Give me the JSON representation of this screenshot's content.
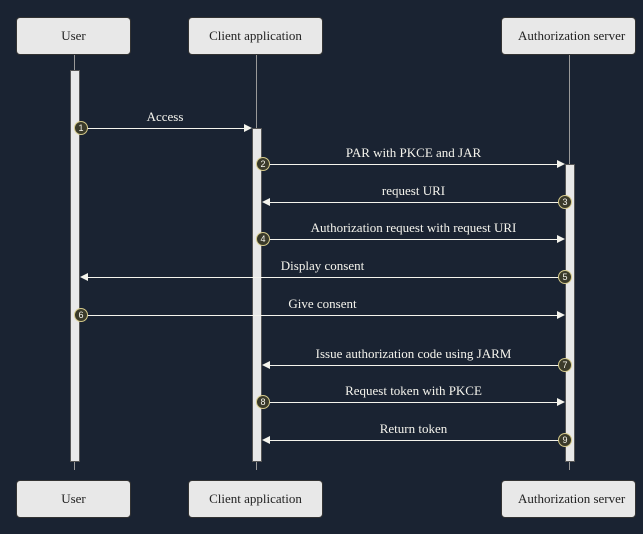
{
  "participants": {
    "user": "User",
    "client": "Client application",
    "server": "Authorization server"
  },
  "messages": {
    "m1": {
      "seq": "1",
      "label": "Access"
    },
    "m2": {
      "seq": "2",
      "label": "PAR with PKCE and JAR"
    },
    "m3": {
      "seq": "3",
      "label": "request URI"
    },
    "m4": {
      "seq": "4",
      "label": "Authorization request with request URI"
    },
    "m5": {
      "seq": "5",
      "label": "Display consent"
    },
    "m6": {
      "seq": "6",
      "label": "Give consent"
    },
    "m7": {
      "seq": "7",
      "label": "Issue authorization code using JARM"
    },
    "m8": {
      "seq": "8",
      "label": "Request token with PKCE"
    },
    "m9": {
      "seq": "9",
      "label": "Return token"
    }
  }
}
